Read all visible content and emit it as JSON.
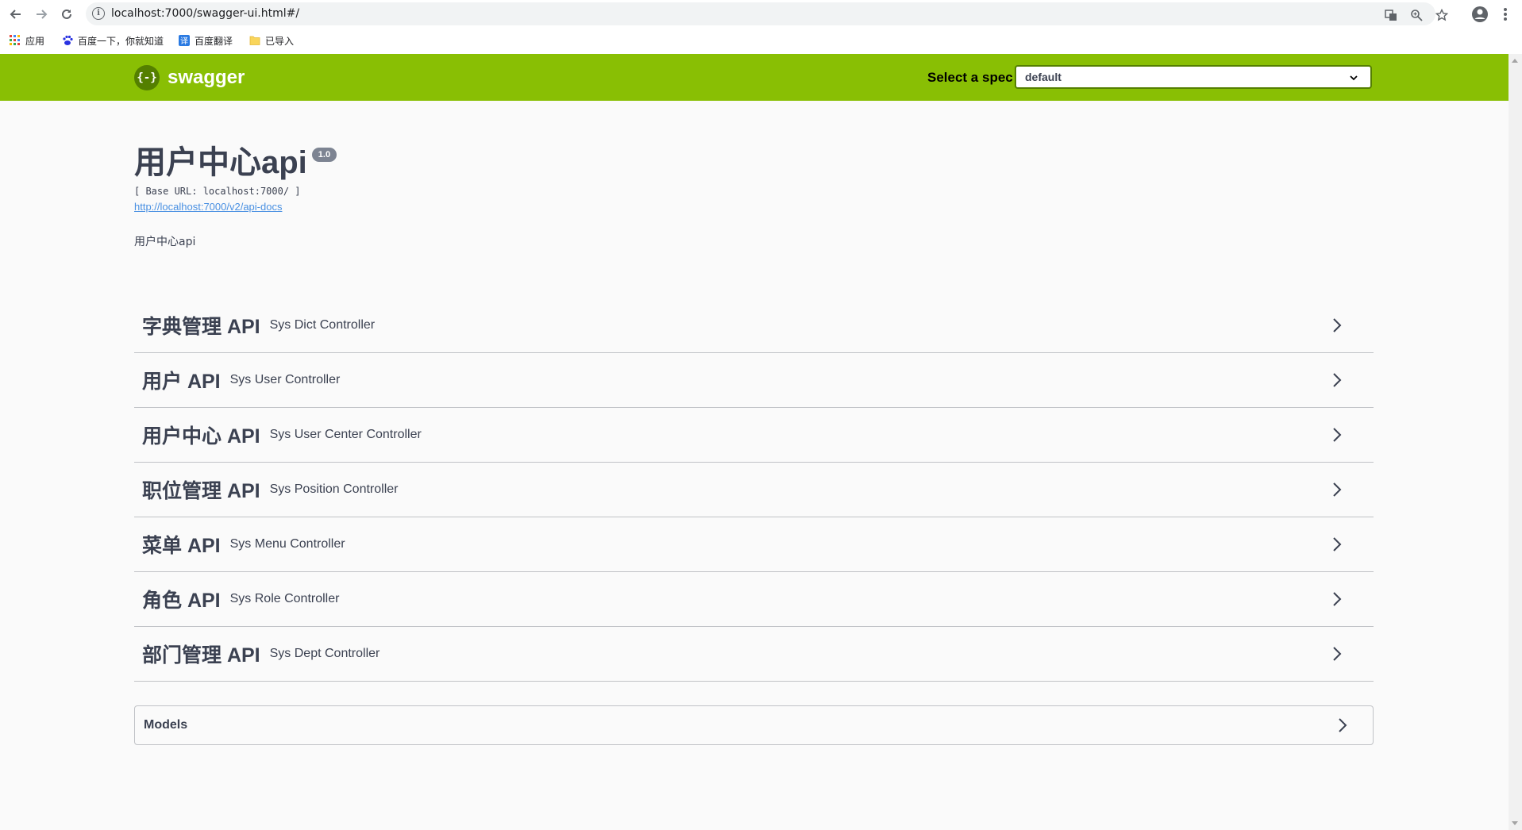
{
  "browser": {
    "url": "localhost:7000/swagger-ui.html#/",
    "bookmarks": [
      {
        "label": "应用",
        "icon": "apps-grid-icon"
      },
      {
        "label": "百度一下，你就知道",
        "icon": "baidu-paw-icon"
      },
      {
        "label": "百度翻译",
        "icon": "baidu-translate-icon"
      },
      {
        "label": "已导入",
        "icon": "folder-icon"
      }
    ]
  },
  "topbar": {
    "logo_text": "swagger",
    "logo_mark": "{-}",
    "spec_label": "Select a spec",
    "spec_value": "default",
    "color": "#89bf04"
  },
  "info": {
    "title": "用户中心api",
    "version": "1.0",
    "base_url": "[ Base URL: localhost:7000/ ]",
    "docs_link": "http://localhost:7000/v2/api-docs",
    "description": "用户中心api"
  },
  "tags": [
    {
      "name": "字典管理 API",
      "description": "Sys Dict Controller"
    },
    {
      "name": "用户 API",
      "description": "Sys User Controller"
    },
    {
      "name": "用户中心 API",
      "description": "Sys User Center Controller"
    },
    {
      "name": "职位管理 API",
      "description": "Sys Position Controller"
    },
    {
      "name": "菜单 API",
      "description": "Sys Menu Controller"
    },
    {
      "name": "角色 API",
      "description": "Sys Role Controller"
    },
    {
      "name": "部门管理 API",
      "description": "Sys Dept Controller"
    }
  ],
  "models": {
    "title": "Models"
  }
}
